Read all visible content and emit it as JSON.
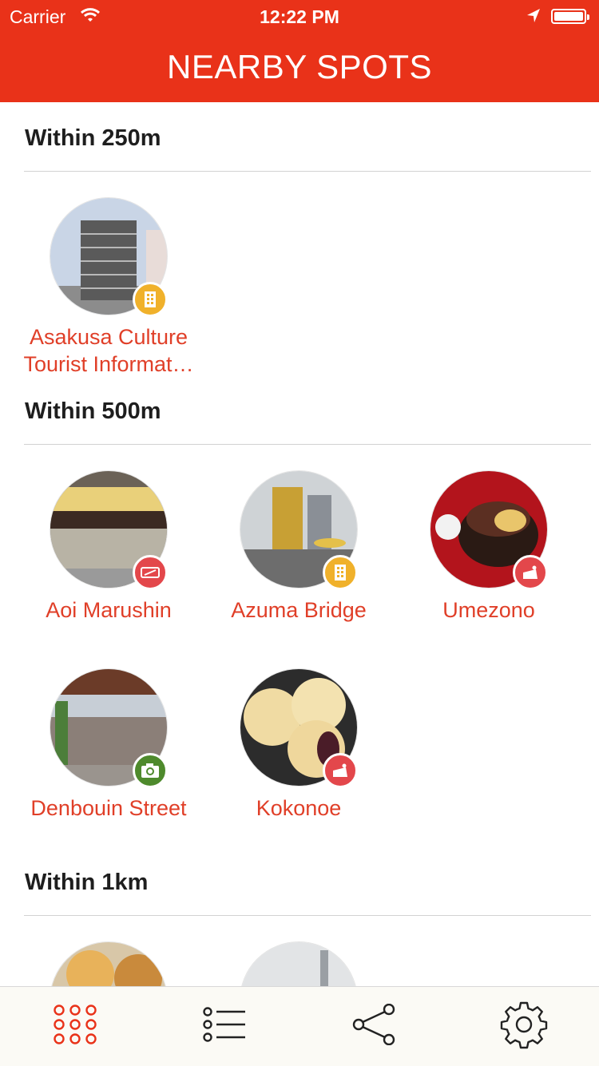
{
  "status_bar": {
    "carrier": "Carrier",
    "time": "12:22 PM"
  },
  "header": {
    "title": "NEARBY SPOTS"
  },
  "sections": [
    {
      "title": "Within 250m",
      "spots": [
        {
          "name": "Asakusa Culture Tourist Informat…",
          "category_icon": "building-icon",
          "badge_color": "#f0b12b"
        }
      ]
    },
    {
      "title": "Within 500m",
      "spots": [
        {
          "name": "Aoi Marushin",
          "category_icon": "restaurant-icon",
          "badge_color": "#e3474b"
        },
        {
          "name": "Azuma Bridge",
          "category_icon": "building-icon",
          "badge_color": "#f0b12b"
        },
        {
          "name": "Umezono",
          "category_icon": "cake-icon",
          "badge_color": "#e3474b"
        },
        {
          "name": "Denbouin Street",
          "category_icon": "camera-icon",
          "badge_color": "#4e8a2c"
        },
        {
          "name": "Kokonoe",
          "category_icon": "cake-icon",
          "badge_color": "#e3474b"
        }
      ]
    },
    {
      "title": "Within 1km",
      "spots": []
    }
  ],
  "tab_bar": {
    "tabs": [
      "grid-icon",
      "list-icon",
      "share-icon",
      "settings-icon"
    ],
    "active_color": "#e93219",
    "inactive_color": "#222222"
  },
  "colors": {
    "accent": "#e93219",
    "spot_name": "#e03f28"
  }
}
